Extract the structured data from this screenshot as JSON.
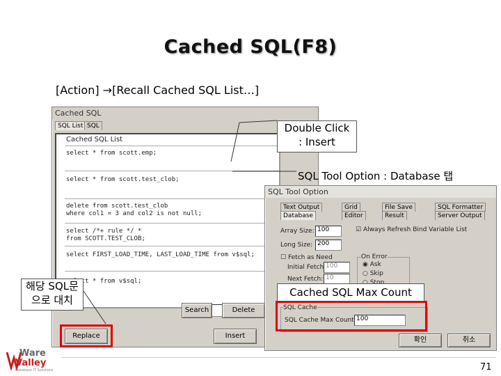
{
  "slide": {
    "title": "Cached SQL(F8)",
    "subtitle": "[Action] →[Recall Cached SQL List…]",
    "page_number": "71"
  },
  "cached_sql_dialog": {
    "title": "Cached SQL",
    "tabs": [
      "SQL List",
      "SQL"
    ],
    "list_header": "Cached SQL List",
    "items": [
      "select * from scott.emp;",
      "select * from scott.test_clob;",
      "delete from scott.test_clob\nwhere col1 = 3 and col2 is not null;",
      "select /*+ rule */ *\nfrom SCOTT.TEST_CLOB;",
      "select FIRST_LOAD_TIME, LAST_LOAD_TIME from v$sql;",
      "select * from v$sql;"
    ],
    "search_label": "Search",
    "delete_label": "Delete",
    "replace_label": "Replace",
    "insert_label": "Insert"
  },
  "sql_tool_option": {
    "title": "SQL Tool Option",
    "tabs_row1": [
      "Text Output",
      "Grid",
      "File Save",
      "SQL Formatter"
    ],
    "tabs_row2": [
      "Database",
      "Editor",
      "Result",
      "Server Output"
    ],
    "array_size_label": "Array Size:",
    "array_size_value": "100",
    "long_size_label": "Long Size:",
    "long_size_value": "200",
    "always_refresh_label": "Always Refresh Bind Variable List",
    "fetch_label": "Fetch as Need",
    "initial_fetch_label": "Initial Fetch:",
    "initial_fetch_value": "100",
    "next_fetch_label": "Next Fetch:",
    "next_fetch_value": "10",
    "on_error_label": "On Error",
    "on_error_options": [
      "Ask",
      "Skip",
      "Stop"
    ],
    "sql_cache_group": "SQL Cache",
    "sql_cache_max_label": "SQL Cache Max Count:",
    "sql_cache_max_value": "100",
    "ok_label": "확인",
    "cancel_label": "취소"
  },
  "callouts": {
    "double_click": "Double Click\n: Insert",
    "sql_tool_option": "SQL Tool Option : Database 탭",
    "replace_note": "해당 SQL문\n으로 대치",
    "max_count": "Cached SQL Max Count"
  },
  "logo": {
    "line1": "Ware",
    "line2": "Valley",
    "tagline": "Database IT Solutions"
  },
  "colors": {
    "highlight_red": "#e00000",
    "logo_red": "#c81e1e",
    "dialog_gray": "#d4d0c8"
  }
}
